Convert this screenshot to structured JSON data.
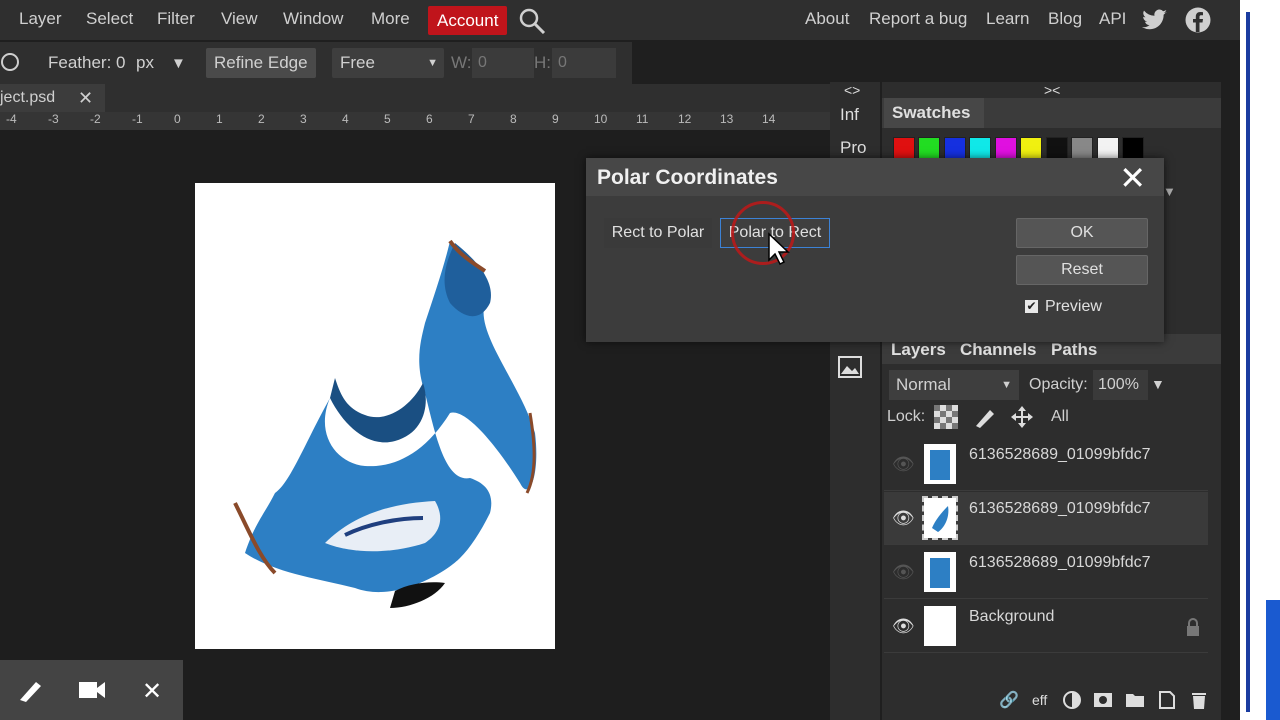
{
  "menu": {
    "items": [
      "Layer",
      "Select",
      "Filter",
      "View",
      "Window",
      "More"
    ],
    "account": "Account",
    "right_items": [
      "About",
      "Report a bug",
      "Learn",
      "Blog",
      "API"
    ]
  },
  "options": {
    "feather_label": "Feather:",
    "feather_value": "0",
    "feather_unit": "px",
    "refine_edge": "Refine Edge",
    "style_value": "Free",
    "w_label": "W:",
    "w_value": "0",
    "h_label": "H:",
    "h_value": "0"
  },
  "document": {
    "tab_name": "ject.psd",
    "ruler_ticks": [
      "-4",
      "-3",
      "-2",
      "-1",
      "0",
      "1",
      "2",
      "3",
      "4",
      "5",
      "6",
      "7",
      "8",
      "9",
      "10",
      "11",
      "12",
      "13",
      "14"
    ]
  },
  "side_collapse": {
    "arrows_left": "<>",
    "arrows_right": "><",
    "info": "Inf",
    "properties": "Pro"
  },
  "swatches": {
    "title": "Swatches",
    "colors": [
      "#e01010",
      "#22dd22",
      "#1530e0",
      "#10e8e8",
      "#e010e0",
      "#f0f010",
      "#111111",
      "#888888",
      "#f2f2f2",
      "#000000"
    ]
  },
  "dialog": {
    "title": "Polar Coordinates",
    "rect_to_polar": "Rect to Polar",
    "polar_to_rect": "Polar to Rect",
    "ok": "OK",
    "reset": "Reset",
    "preview_label": "Preview",
    "preview_checked": true
  },
  "layers_panel": {
    "tabs": [
      "Layers",
      "Channels",
      "Paths"
    ],
    "blend_mode": "Normal",
    "opacity_label": "Opacity:",
    "opacity_value": "100%",
    "lock_label": "Lock:",
    "lock_all": "All",
    "layers": [
      {
        "name": "6136528689_01099bfdc7",
        "visible": false,
        "selected": false
      },
      {
        "name": "6136528689_01099bfdc7",
        "visible": true,
        "selected": true
      },
      {
        "name": "6136528689_01099bfdc7",
        "visible": false,
        "selected": false
      },
      {
        "name": "Background",
        "visible": true,
        "selected": false,
        "locked": true
      }
    ],
    "footer_eff": "eff"
  },
  "colors": {
    "account_red": "#c0141b",
    "accent_blue": "#3c82d6"
  }
}
